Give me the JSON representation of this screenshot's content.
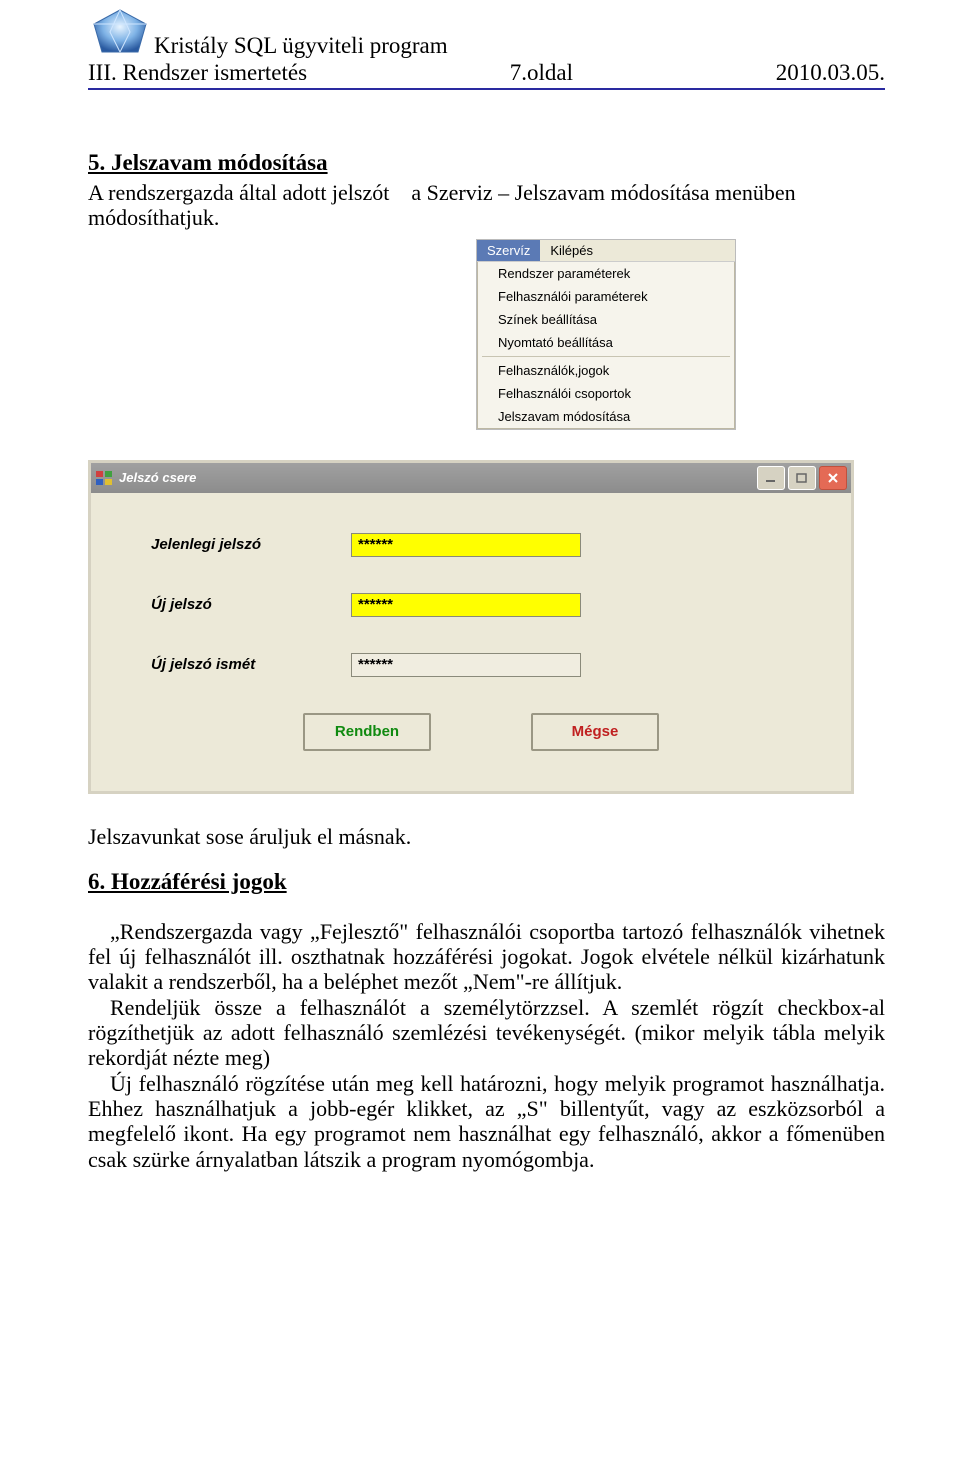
{
  "header": {
    "program_title": "Kristály SQL ügyviteli program",
    "chapter": "III. Rendszer ismertetés",
    "page_label": "7.oldal",
    "date": "2010.03.05."
  },
  "section5": {
    "title": "5. Jelszavam módosítása",
    "intro_a": "A  rendszergazda  által  adott  jelszót",
    "intro_b": "a  Szerviz  –  Jelszavam  módosítása  menüben",
    "intro_c": "módosíthatjuk."
  },
  "menu": {
    "bar": {
      "serviz": "Szervíz",
      "kilepes": "Kilépés"
    },
    "items_a": [
      "Rendszer paraméterek",
      "Felhasználói paraméterek",
      "Színek beállítása",
      "Nyomtató beállítása"
    ],
    "items_b": [
      "Felhasználók,jogok",
      "Felhasználói csoportok",
      "Jelszavam módosítása"
    ]
  },
  "dialog": {
    "title": "Jelszó csere",
    "field1_label": "Jelenlegi jelszó",
    "field2_label": "Új jelszó",
    "field3_label": "Új jelszó ismét",
    "mask": "******",
    "ok": "Rendben",
    "cancel": "Mégse"
  },
  "after_dialog": "Jelszavunkat sose áruljuk el másnak.",
  "section6": {
    "title": "6. Hozzáférési jogok",
    "p1": "„Rendszergazda vagy „Fejlesztő\" felhasználói csoportba tartozó felhasználók vihetnek fel új felhasználót ill. oszthatnak hozzáférési  jogokat. Jogok elvétele nélkül kizárhatunk valakit a rendszerből, ha a beléphet mezőt „Nem\"-re állítjuk.",
    "p2": "Rendeljük össze a felhasználót a személytörzzsel. A szemlét rögzít checkbox-al rögzíthetjük az adott felhasználó szemlézési tevékenységét. (mikor melyik tábla melyik rekordját nézte meg)",
    "p3": "Új felhasználó rögzítése után meg kell határozni, hogy melyik programot használhatja. Ehhez használhatjuk a jobb-egér klikket, az „S\"  billentyűt, vagy az eszközsorból a megfelelő ikont. Ha egy programot nem használhat egy felhasználó, akkor a főmenüben csak szürke árnyalatban látszik a program nyomógombja."
  }
}
